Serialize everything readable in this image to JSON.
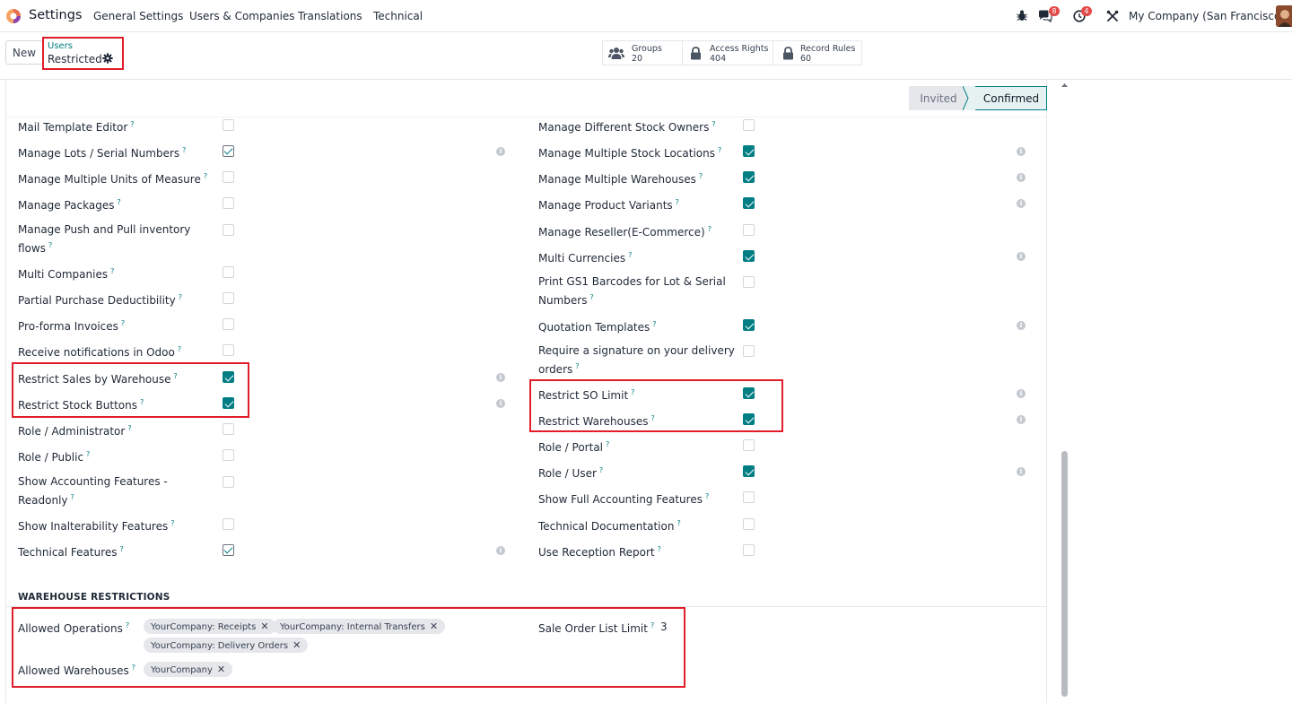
{
  "app": {
    "title": "Settings",
    "menu": [
      "General Settings",
      "Users & Companies",
      "Translations",
      "Technical"
    ],
    "company": "My Company (San Francisco)",
    "messages_count": "8",
    "activities_count": "4"
  },
  "control": {
    "new_label": "New",
    "breadcrumb_parent": "Users",
    "breadcrumb_current": "Restricted",
    "stats": [
      {
        "label": "Groups",
        "value": "20",
        "icon": "users-icon"
      },
      {
        "label": "Access Rights",
        "value": "404",
        "icon": "lock-icon"
      },
      {
        "label": "Record Rules",
        "value": "60",
        "icon": "lock-icon"
      }
    ]
  },
  "status": {
    "stages": [
      "Invited",
      "Confirmed"
    ],
    "current": "Confirmed"
  },
  "permissions": {
    "left": [
      {
        "label": "Mail Template Editor",
        "checked": false,
        "info": false
      },
      {
        "label": "Manage Lots / Serial Numbers",
        "checked": true,
        "info": true
      },
      {
        "label": "Manage Multiple Units of Measure",
        "checked": false,
        "info": false
      },
      {
        "label": "Manage Packages",
        "checked": false,
        "info": false
      },
      {
        "label": "Manage Push and Pull inventory",
        "label2": "flows",
        "checked": false,
        "info": false
      },
      {
        "label": "Multi Companies",
        "checked": false,
        "info": false
      },
      {
        "label": "Partial Purchase Deductibility",
        "checked": false,
        "info": false
      },
      {
        "label": "Pro-forma Invoices",
        "checked": false,
        "info": false
      },
      {
        "label": "Receive notifications in Odoo",
        "checked": false,
        "info": false
      },
      {
        "label": "Restrict Sales by Warehouse",
        "checked": true,
        "info": true
      },
      {
        "label": "Restrict Stock Buttons",
        "checked": true,
        "info": true
      },
      {
        "label": "Role / Administrator",
        "checked": false,
        "info": false
      },
      {
        "label": "Role / Public",
        "checked": false,
        "info": false
      },
      {
        "label": "Show Accounting Features -",
        "label2": "Readonly",
        "checked": false,
        "info": false
      },
      {
        "label": "Show Inalterability Features",
        "checked": false,
        "info": false
      },
      {
        "label": "Technical Features",
        "checked": true,
        "info": true
      }
    ],
    "right": [
      {
        "label": "Manage Different Stock Owners",
        "checked": false,
        "info": false
      },
      {
        "label": "Manage Multiple Stock Locations",
        "checked": true,
        "info": true
      },
      {
        "label": "Manage Multiple Warehouses",
        "checked": true,
        "info": true
      },
      {
        "label": "Manage Product Variants",
        "checked": true,
        "info": true
      },
      {
        "label": "Manage Reseller(E-Commerce)",
        "checked": false,
        "info": false
      },
      {
        "label": "Multi Currencies",
        "checked": true,
        "info": true
      },
      {
        "label": "Print GS1 Barcodes for Lot & Serial",
        "label2": "Numbers",
        "checked": false,
        "info": false
      },
      {
        "label": "Quotation Templates",
        "checked": true,
        "info": true
      },
      {
        "label": "Require a signature on your delivery",
        "label2": "orders",
        "checked": false,
        "info": false
      },
      {
        "label": "Restrict SO Limit",
        "checked": true,
        "info": true
      },
      {
        "label": "Restrict Warehouses",
        "checked": true,
        "info": true
      },
      {
        "label": "Role / Portal",
        "checked": false,
        "info": false
      },
      {
        "label": "Role / User",
        "checked": true,
        "info": true
      },
      {
        "label": "Show Full Accounting Features",
        "checked": false,
        "info": false
      },
      {
        "label": "Technical Documentation",
        "checked": false,
        "info": false
      },
      {
        "label": "Use Reception Report",
        "checked": false,
        "info": false
      }
    ]
  },
  "warehouse": {
    "section_title": "WAREHOUSE RESTRICTIONS",
    "allowed_operations_label": "Allowed Operations",
    "allowed_operations": [
      "YourCompany: Receipts",
      "YourCompany: Internal Transfers",
      "YourCompany: Delivery Orders"
    ],
    "allowed_warehouses_label": "Allowed Warehouses",
    "allowed_warehouses": [
      "YourCompany"
    ],
    "sale_order_limit_label": "Sale Order List Limit",
    "sale_order_limit_value": "3"
  },
  "colors": {
    "accent": "#017e84",
    "highlight": "#e11d2a"
  }
}
